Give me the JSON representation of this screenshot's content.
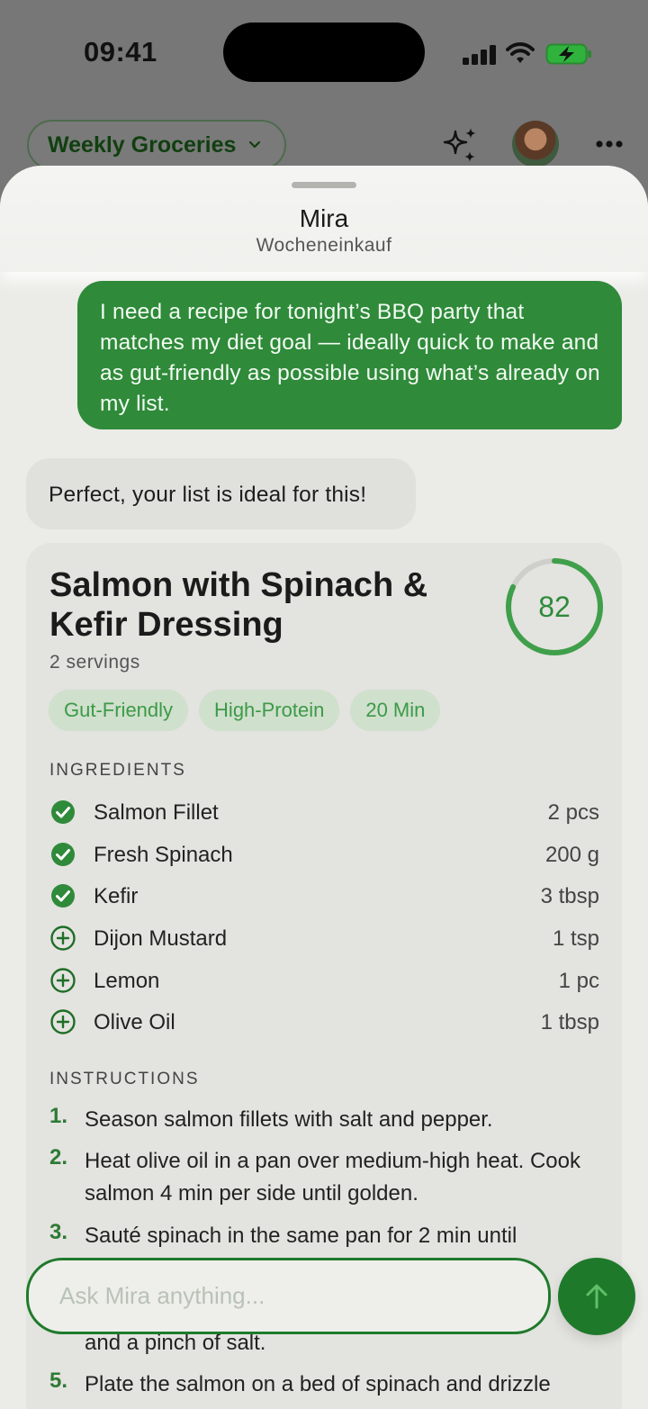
{
  "status_bar": {
    "time": "09:41"
  },
  "top_bar": {
    "list_name": "Weekly Groceries",
    "icons": [
      "chevron-down-icon",
      "sparkles-icon",
      "avatar",
      "more-icon"
    ]
  },
  "sheet": {
    "title": "Mira",
    "subtitle": "Wocheneinkauf"
  },
  "messages": {
    "user": "I need a recipe for tonight’s BBQ party that matches my diet goal — ideally quick to make and as gut-friendly as possible using what’s already on my list.",
    "assistant": "Perfect, your list is ideal for this!"
  },
  "recipe": {
    "title": "Salmon with Spinach & Kefir Dressing",
    "servings": "2 servings",
    "score": "82",
    "score_fraction": 0.82,
    "tags": [
      "Gut-Friendly",
      "High-Protein",
      "20 Min"
    ],
    "ingredients_label": "INGREDIENTS",
    "ingredients": [
      {
        "name": "Salmon Fillet",
        "qty": "2 pcs",
        "on_list": true
      },
      {
        "name": "Fresh Spinach",
        "qty": "200 g",
        "on_list": true
      },
      {
        "name": "Kefir",
        "qty": "3 tbsp",
        "on_list": true
      },
      {
        "name": "Dijon Mustard",
        "qty": "1 tsp",
        "on_list": false
      },
      {
        "name": "Lemon",
        "qty": "1 pc",
        "on_list": false
      },
      {
        "name": "Olive Oil",
        "qty": "1 tbsp",
        "on_list": false
      }
    ],
    "instructions_label": "INSTRUCTIONS",
    "steps": [
      {
        "num": "1.",
        "text": "Season salmon fillets with salt and pepper."
      },
      {
        "num": "2.",
        "text": "Heat olive oil in a pan over medium-high heat. Cook salmon 4 min per side until golden."
      },
      {
        "num": "3.",
        "text": "Sauté spinach in the same pan for 2 min until"
      },
      {
        "num": "",
        "text": "and a pinch of salt."
      },
      {
        "num": "5.",
        "text": "Plate the salmon on a bed of spinach and drizzle"
      }
    ]
  },
  "composer": {
    "placeholder": "Ask Mira anything..."
  },
  "colors": {
    "accent": "#2f8a3a",
    "accent_dark": "#1e7a2a",
    "tag_bg": "#cfe0cc",
    "card_bg": "#e3e3df"
  }
}
